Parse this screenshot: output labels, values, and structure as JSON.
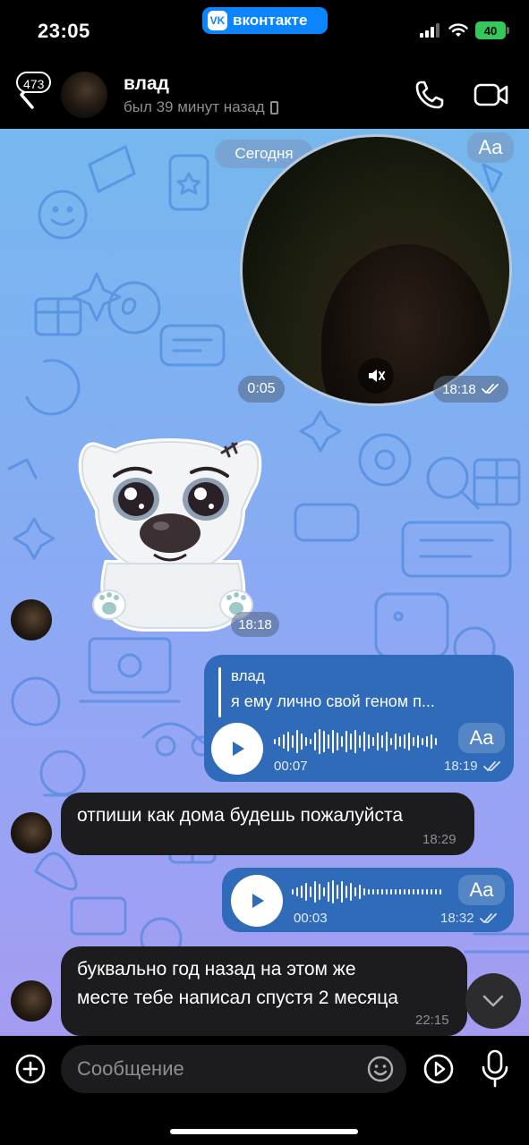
{
  "status_bar": {
    "time": "23:05",
    "vk_badge": "вконтакте",
    "vk_logo": "VK",
    "battery": "40"
  },
  "header": {
    "unread_count": "473",
    "name": "влад",
    "status": "был 39 минут назад"
  },
  "chat": {
    "date_label": "Сегодня",
    "aa_label": "Aa",
    "video_message": {
      "duration": "0:05",
      "time": "18:18"
    },
    "sticker": {
      "time": "18:18"
    },
    "voice_reply": {
      "reply_author": "влад",
      "reply_text": "я ему лично свой геном п...",
      "duration": "00:07",
      "time": "18:19",
      "aa": "Aa"
    },
    "msg1": {
      "text": "отпиши как дома будешь пожалуйста",
      "time": "18:29"
    },
    "voice2": {
      "duration": "00:03",
      "time": "18:32",
      "aa": "Aa"
    },
    "msg2": {
      "line1": "буквально год назад на этом же",
      "line2": "месте тебе написал спустя 2 месяца",
      "time": "22:15"
    }
  },
  "composer": {
    "placeholder": "Сообщение"
  },
  "colors": {
    "outgoing_bubble": "#2f6bb8",
    "incoming_bubble": "#1c1c1e",
    "chat_gradient_top": "#76b8ee",
    "chat_gradient_bottom": "#a59cf2",
    "accent": "#0a84ff"
  }
}
